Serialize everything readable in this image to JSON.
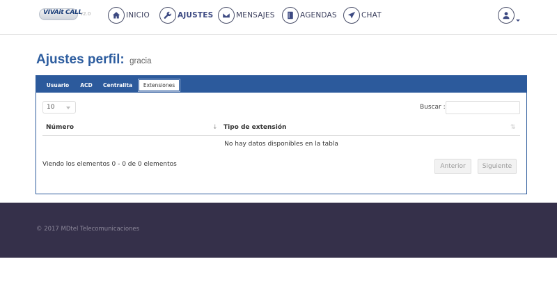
{
  "logo": {
    "brand": "VIVAit CALL",
    "version": "v2.0"
  },
  "nav": [
    {
      "label": "INICIO",
      "icon": "home-icon",
      "active": false
    },
    {
      "label": "AJUSTES",
      "icon": "wrench-icon",
      "active": true
    },
    {
      "label": "MENSAJES",
      "icon": "envelope-icon",
      "active": false
    },
    {
      "label": "AGENDAS",
      "icon": "book-icon",
      "active": false
    },
    {
      "label": "CHAT",
      "icon": "send-icon",
      "active": false
    }
  ],
  "user_menu": {
    "icon": "user-icon"
  },
  "page": {
    "title": "Ajustes perfil:",
    "subtitle": "gracia"
  },
  "tabs": [
    {
      "label": "Usuario",
      "active": false
    },
    {
      "label": "ACD",
      "active": false
    },
    {
      "label": "Centralita",
      "active": false
    },
    {
      "label": "Extensiones",
      "active": true
    }
  ],
  "table": {
    "page_length": "10",
    "search_label": "Buscar :",
    "search_value": "",
    "columns": [
      "Número",
      "Tipo de extensión"
    ],
    "empty_message": "No hay datos disponibles en la tabla",
    "info": "Viendo los elementos 0 - 0 de 0 elementos",
    "prev_label": "Anterior",
    "next_label": "Siguiente"
  },
  "footer": {
    "text": "© 2017 MDtel Telecomunicaciones"
  },
  "colors": {
    "primary": "#2c5a9c",
    "footer_bg": "#35304a",
    "title": "#2d5d9f"
  }
}
